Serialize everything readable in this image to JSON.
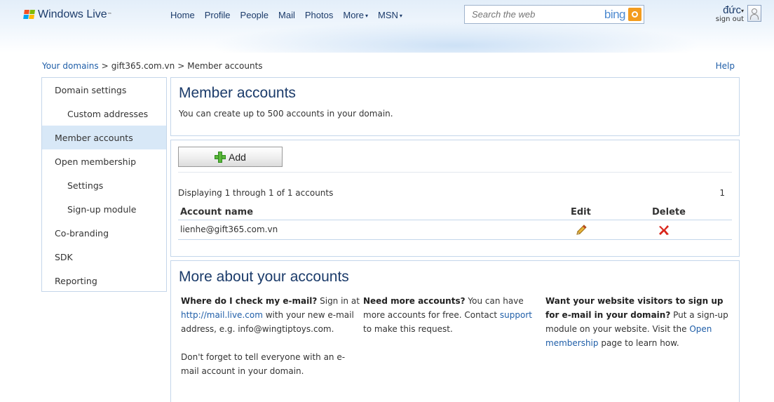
{
  "header": {
    "brand": "Windows Live",
    "tm": "™",
    "nav": [
      {
        "label": "Home"
      },
      {
        "label": "Profile"
      },
      {
        "label": "People"
      },
      {
        "label": "Mail"
      },
      {
        "label": "Photos"
      },
      {
        "label": "More",
        "caret": "▾"
      },
      {
        "label": "MSN",
        "caret": "▾"
      }
    ],
    "search_placeholder": "Search the web",
    "search_brand": "bing",
    "user_name": "đức",
    "user_caret": "▾",
    "sign_out": "sign out"
  },
  "breadcrumb": {
    "items": [
      "Your domains",
      "gift365.com.vn",
      "Member accounts"
    ],
    "separator": ">"
  },
  "help": "Help",
  "sidebar": {
    "items": [
      {
        "label": "Domain settings"
      },
      {
        "label": "Custom addresses"
      },
      {
        "label": "Member accounts"
      },
      {
        "label": "Open membership"
      },
      {
        "label": "Settings"
      },
      {
        "label": "Sign-up module"
      },
      {
        "label": "Co-branding"
      },
      {
        "label": "SDK"
      },
      {
        "label": "Reporting"
      }
    ]
  },
  "summary": {
    "title": "Member accounts",
    "description": "You can create up to 500 accounts in your domain."
  },
  "accounts": {
    "add_label": "Add",
    "count_text": "Displaying 1 through 1 of 1 accounts",
    "page": "1",
    "columns": {
      "name": "Account name",
      "edit": "Edit",
      "delete": "Delete"
    },
    "rows": [
      {
        "name": "lienhe@gift365.com.vn"
      }
    ]
  },
  "more": {
    "title": "More about your accounts",
    "col1": {
      "q": "Where do I check my e-mail?",
      "t1": " Sign in at ",
      "link": "http://mail.live.com",
      "t2": " with your new e-mail address, e.g. info@wingtiptoys.com.",
      "t3": "Don't forget to tell everyone with an e-mail account in your domain."
    },
    "col2": {
      "q": "Need more accounts?",
      "t1": " You can have more accounts for free. Contact ",
      "link": "support",
      "t2": " to make this request."
    },
    "col3": {
      "q": "Want your website visitors to sign up for e-mail in your domain?",
      "t1": " Put a sign-up module on your website. Visit the ",
      "link": "Open membership",
      "t2": " page to learn how."
    }
  },
  "colors": {
    "accent": "#1f5ea8",
    "title": "#1b3b6a",
    "border": "#c4d6ea",
    "active": "#d8e8f7"
  }
}
